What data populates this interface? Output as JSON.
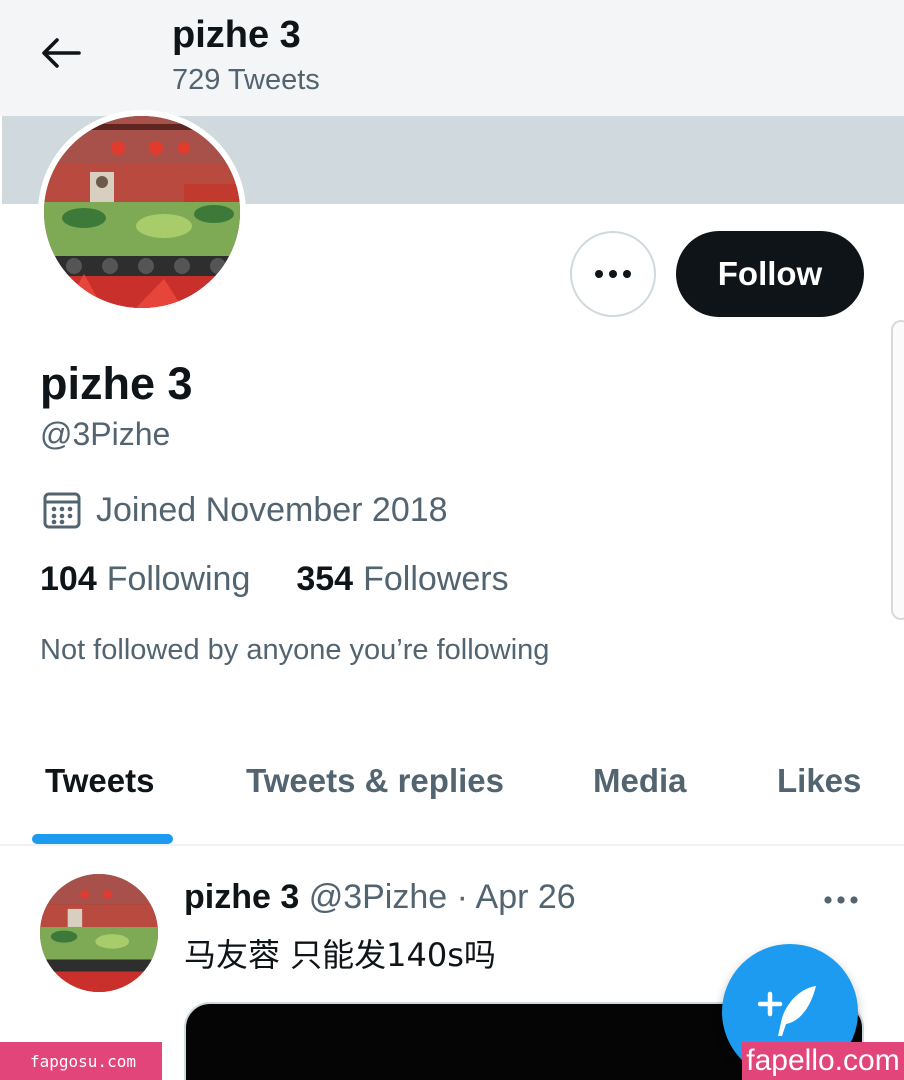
{
  "header": {
    "title": "pizhe 3",
    "tweet_count": "729 Tweets"
  },
  "profile": {
    "display_name": "pizhe 3",
    "handle": "@3Pizhe",
    "joined": "Joined November 2018",
    "following_count": "104",
    "following_label": "Following",
    "followers_count": "354",
    "followers_label": "Followers",
    "not_followed_text": "Not followed by anyone you’re following",
    "follow_label": "Follow"
  },
  "tabs": [
    {
      "label": "Tweets",
      "active": true
    },
    {
      "label": "Tweets & replies",
      "active": false
    },
    {
      "label": "Media",
      "active": false
    },
    {
      "label": "Likes",
      "active": false
    }
  ],
  "tweet": {
    "name": "pizhe 3",
    "handle": "@3Pizhe",
    "separator": "·",
    "date": "Apr 26",
    "text": "马友蓉 只能发140s吗"
  },
  "watermarks": {
    "left": "fapgosu.com",
    "right": "fapello.com"
  },
  "colors": {
    "accent": "#1d9bf0",
    "text_primary": "#0f1419",
    "text_secondary": "#536471",
    "banner": "#cfd9de",
    "watermark": "#e2457a"
  },
  "icons": {
    "back": "arrow-left-icon",
    "more": "more-horizontal-icon",
    "calendar": "calendar-icon",
    "compose": "compose-tweet-icon"
  }
}
